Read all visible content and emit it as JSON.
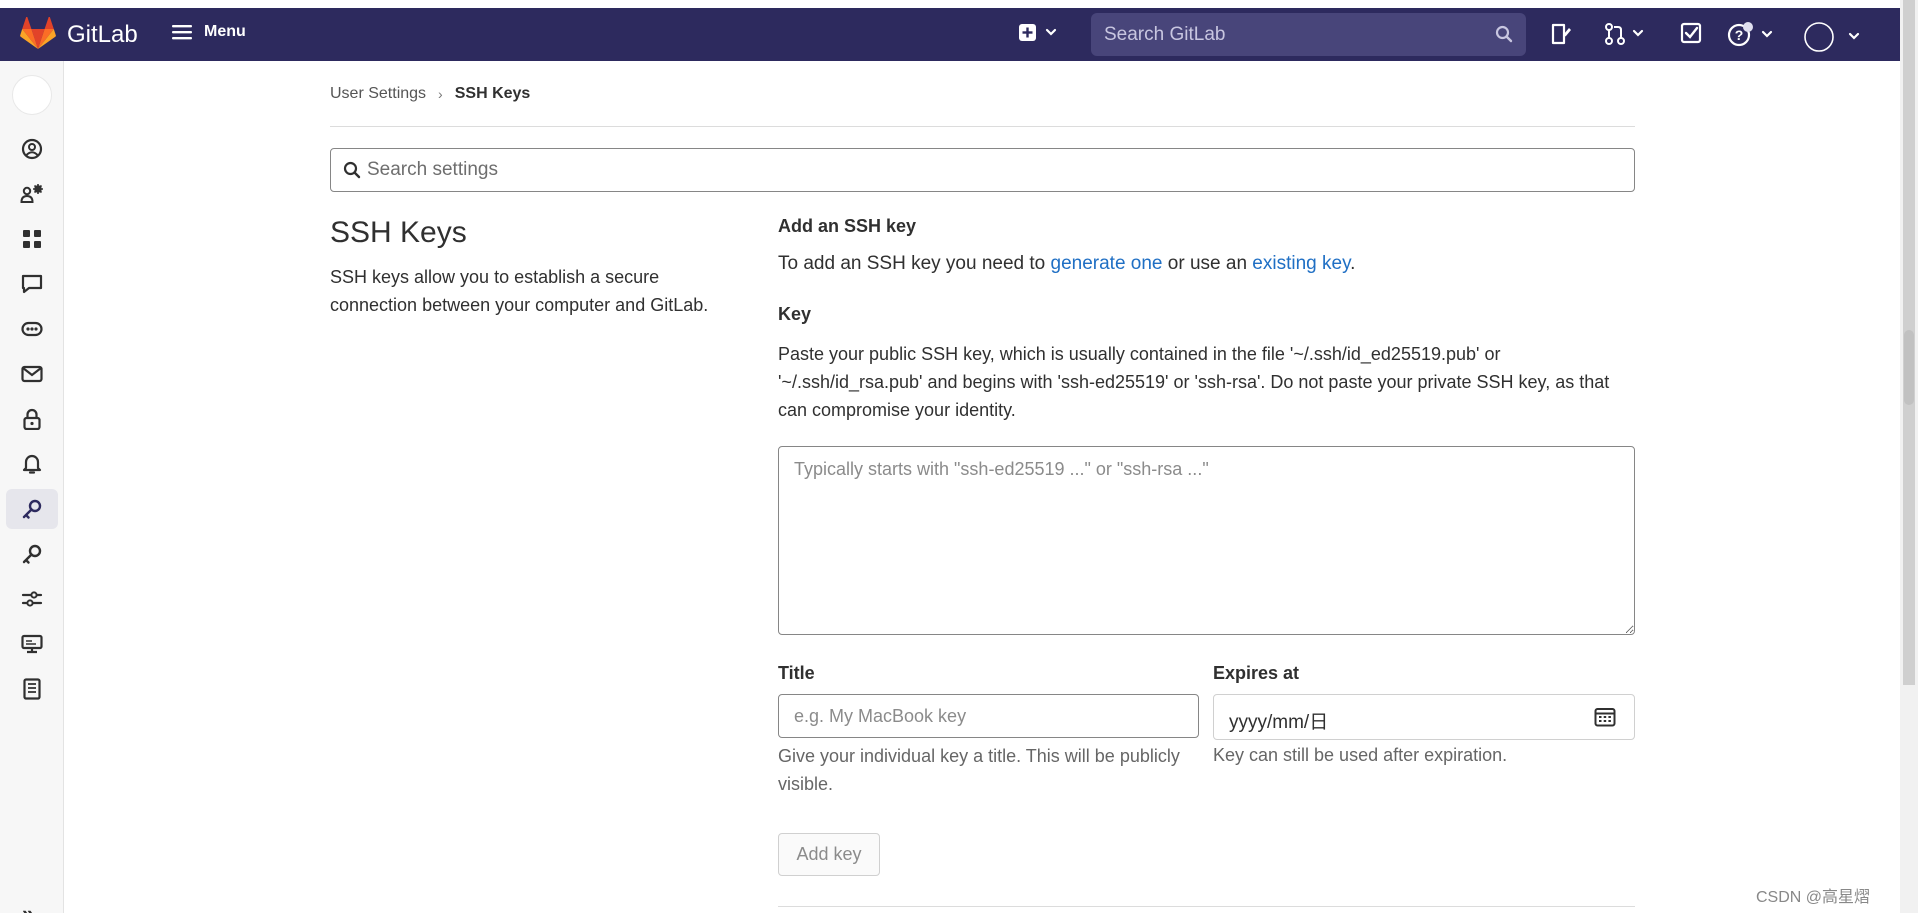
{
  "navbar": {
    "brand": "GitLab",
    "menu_label": "Menu",
    "search_placeholder": "Search GitLab"
  },
  "breadcrumb": {
    "parent": "User Settings",
    "current": "SSH Keys"
  },
  "settings_search": {
    "placeholder": "Search settings"
  },
  "section": {
    "title": "SSH Keys",
    "description": "SSH keys allow you to establish a secure connection between your computer and GitLab."
  },
  "form": {
    "heading": "Add an SSH key",
    "intro_prefix": "To add an SSH key you need to ",
    "intro_link1": "generate one",
    "intro_middle": " or use an ",
    "intro_link2": "existing key",
    "intro_suffix": ".",
    "key_label": "Key",
    "key_help": "Paste your public SSH key, which is usually contained in the file '~/.ssh/id_ed25519.pub' or '~/.ssh/id_rsa.pub' and begins with 'ssh-ed25519' or 'ssh-rsa'. Do not paste your private SSH key, as that can compromise your identity.",
    "key_placeholder": "Typically starts with \"ssh-ed25519 ...\" or \"ssh-rsa ...\"",
    "title_label": "Title",
    "title_placeholder": "e.g. My MacBook key",
    "title_help": "Give your individual key a title. This will be publicly visible.",
    "expires_label": "Expires at",
    "expires_value": "yyyy/mm/日",
    "expires_help": "Key can still be used after expiration.",
    "submit_label": "Add key"
  },
  "watermark": "CSDN @高星熠",
  "colors": {
    "navbar_bg": "#2d2a5e",
    "link": "#1f6fc4",
    "logo_orange": "#e24329"
  }
}
